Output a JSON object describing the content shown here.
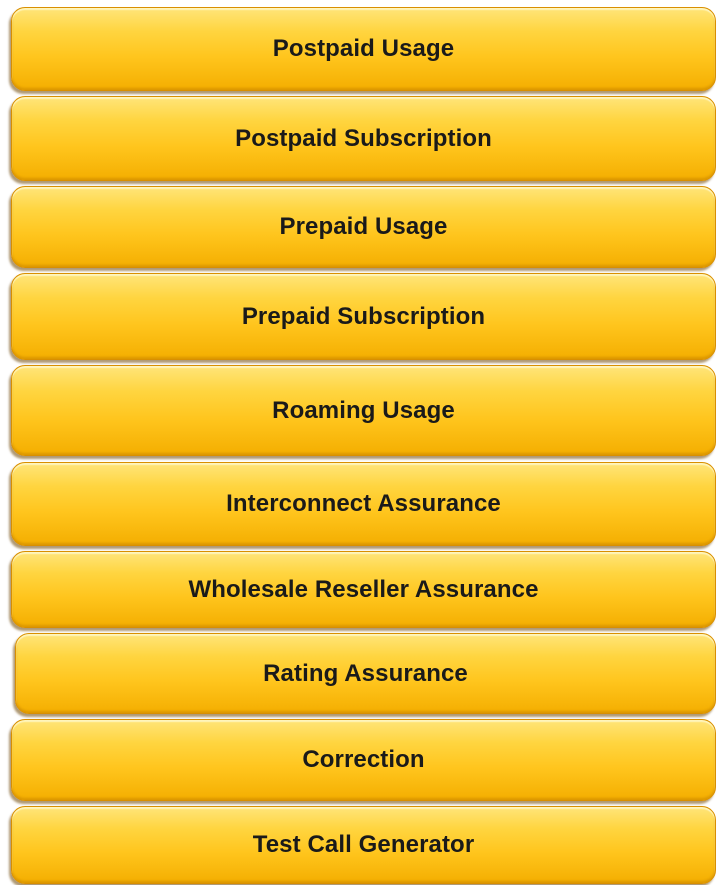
{
  "menu": {
    "items": [
      {
        "label": "Postpaid Usage"
      },
      {
        "label": "Postpaid Subscription"
      },
      {
        "label": "Prepaid Usage"
      },
      {
        "label": "Prepaid Subscription"
      },
      {
        "label": "Roaming Usage"
      },
      {
        "label": "Interconnect Assurance"
      },
      {
        "label": "Wholesale Reseller Assurance"
      },
      {
        "label": "Rating Assurance"
      },
      {
        "label": "Correction"
      },
      {
        "label": "Test Call Generator"
      }
    ]
  },
  "colors": {
    "button_top": "#ffe57a",
    "button_mid": "#ffd540",
    "button_bottom": "#f4ae00",
    "button_border": "#d98f00",
    "label_text": "#1a1a1a"
  }
}
